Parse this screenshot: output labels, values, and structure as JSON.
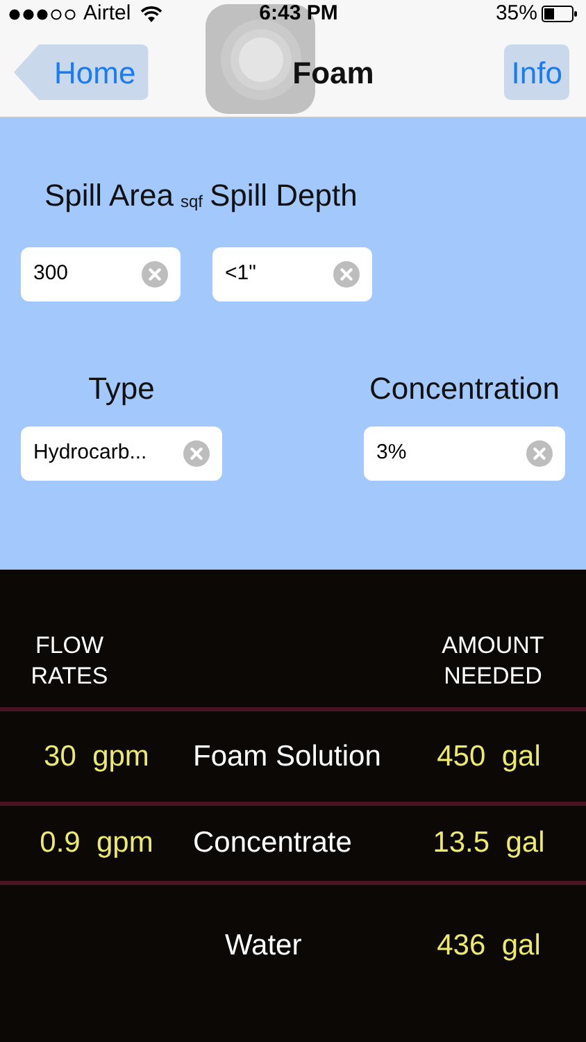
{
  "status_bar": {
    "carrier": "Airtel",
    "time": "6:43 PM",
    "battery": "35%"
  },
  "nav": {
    "back": "Home",
    "title": "Foam",
    "info": "Info"
  },
  "inputs": {
    "spill_area_label": "Spill Area",
    "unit": "sqf",
    "spill_depth_label": "Spill Depth",
    "spill_area": "300",
    "spill_depth": "<1\"",
    "type_label": "Type",
    "type": "Hydrocarb...",
    "concentration_label": "Concentration",
    "concentration": "3%"
  },
  "results": {
    "flow_header": "FLOW\nRATES",
    "amount_header": "AMOUNT\nNEEDED",
    "rows": [
      {
        "kind": "rate",
        "flow": "30",
        "flow_unit": "gpm",
        "label": "Foam Solution",
        "amount": "450",
        "amount_unit": "gal"
      },
      {
        "kind": "rate",
        "flow": "0.9",
        "flow_unit": "gpm",
        "label": "Concentrate",
        "amount": "13.5",
        "amount_unit": "gal"
      },
      {
        "kind": "total",
        "label": "Water",
        "amount": "436",
        "amount_unit": "gal"
      }
    ]
  }
}
